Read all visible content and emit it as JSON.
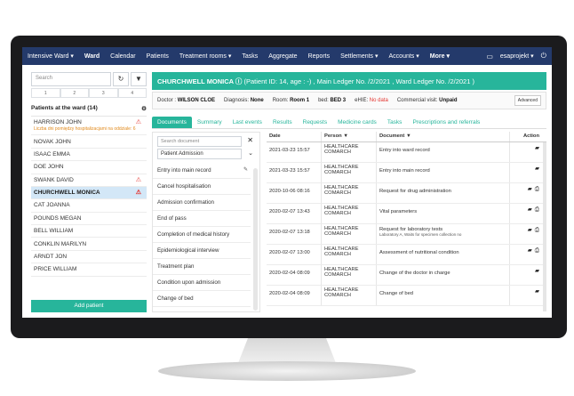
{
  "nav": {
    "items": [
      "Intensive Ward ▾",
      "Ward",
      "Calendar",
      "Patients",
      "Treatment rooms ▾",
      "Tasks",
      "Aggregate",
      "Reports",
      "Settlements ▾",
      "Accounts ▾",
      "More ▾"
    ],
    "user": "esaprojekt ▾"
  },
  "left": {
    "search_placeholder": "Search",
    "pages": [
      "1",
      "2",
      "3",
      "4"
    ],
    "patients_heading": "Patients at the ward (14)",
    "patients": [
      {
        "name": "HARRISON JOHN",
        "note": "Liczba dni pomiędzy hospitalizacjami na oddziale: 6"
      },
      {
        "name": "NOVAK JOHN"
      },
      {
        "name": "ISAAC EMMA"
      },
      {
        "name": "DOE JOHN"
      },
      {
        "name": "SWANK DAVID"
      },
      {
        "name": "CHURCHWELL MONICA"
      },
      {
        "name": "CAT JOANNA"
      },
      {
        "name": "POUNDS MEGAN"
      },
      {
        "name": "BELL WILLIAM"
      },
      {
        "name": "CONKLIN MARILYN"
      },
      {
        "name": "ARNDT JON"
      },
      {
        "name": "PRICE WILLIAM"
      }
    ],
    "add_patient": "Add patient"
  },
  "header": {
    "name": "CHURCHWELL MONICA",
    "details": "(Patient ID: 14, age : -) , Main Ledger No. /2/2021 , Ward Ledger No. /2/2021 )"
  },
  "info": {
    "doctor_label": "Doctor :",
    "doctor": "WILSON CLOE",
    "diagnosis_label": "Diagnosis:",
    "diagnosis": "None",
    "room_label": "Room:",
    "room": "Room 1",
    "bed_label": "bed:",
    "bed": "BED 3",
    "ehie_label": "eHIE:",
    "ehie": "No data",
    "visit_label": "Commercial visit:",
    "visit": "Unpaid",
    "advanced": "Advanced"
  },
  "tabs": [
    "Documents",
    "Summary",
    "Last events",
    "Results",
    "Requests",
    "Medicine cards",
    "Tasks",
    "Prescriptions and referrals"
  ],
  "doc_panel": {
    "search_placeholder": "Search document",
    "selected": "Patient Admission",
    "items": [
      "Entry into main record",
      "Cancel hospitalisation",
      "Admission confirmation",
      "End of pass",
      "Completion of medical history",
      "Epidemiological interview",
      "Treatment plan",
      "Condition upon admission",
      "Change of bed"
    ]
  },
  "table": {
    "headers": {
      "date": "Date",
      "person": "Person",
      "document": "Document",
      "action": "Action"
    },
    "rows": [
      {
        "date": "2021-03-23 15:57",
        "person": "HEALTHCARE COMARCH",
        "document": "Entry into ward record",
        "sub": ""
      },
      {
        "date": "2021-03-23 15:57",
        "person": "HEALTHCARE COMARCH",
        "document": "Entry into main record",
        "sub": ""
      },
      {
        "date": "2020-10-06 08:16",
        "person": "HEALTHCARE COMARCH",
        "document": "Request for drug administration",
        "sub": ""
      },
      {
        "date": "2020-02-07 13:43",
        "person": "HEALTHCARE COMARCH",
        "document": "Vital parameters",
        "sub": ""
      },
      {
        "date": "2020-02-07 13:18",
        "person": "HEALTHCARE COMARCH",
        "document": "Request for laboratory tests",
        "sub": "Laboratory A, Waits for specimen collection no"
      },
      {
        "date": "2020-02-07 13:00",
        "person": "HEALTHCARE COMARCH",
        "document": "Assessment of nutritional condition",
        "sub": ""
      },
      {
        "date": "2020-02-04 08:09",
        "person": "HEALTHCARE COMARCH",
        "document": "Change of the doctor in charge",
        "sub": ""
      },
      {
        "date": "2020-02-04 08:09",
        "person": "HEALTHCARE COMARCH",
        "document": "Change of bed",
        "sub": ""
      }
    ]
  },
  "colors": {
    "nav": "#243a6b",
    "accent": "#27b59b",
    "selected": "#d3e7f7",
    "warning": "#e3342f"
  }
}
